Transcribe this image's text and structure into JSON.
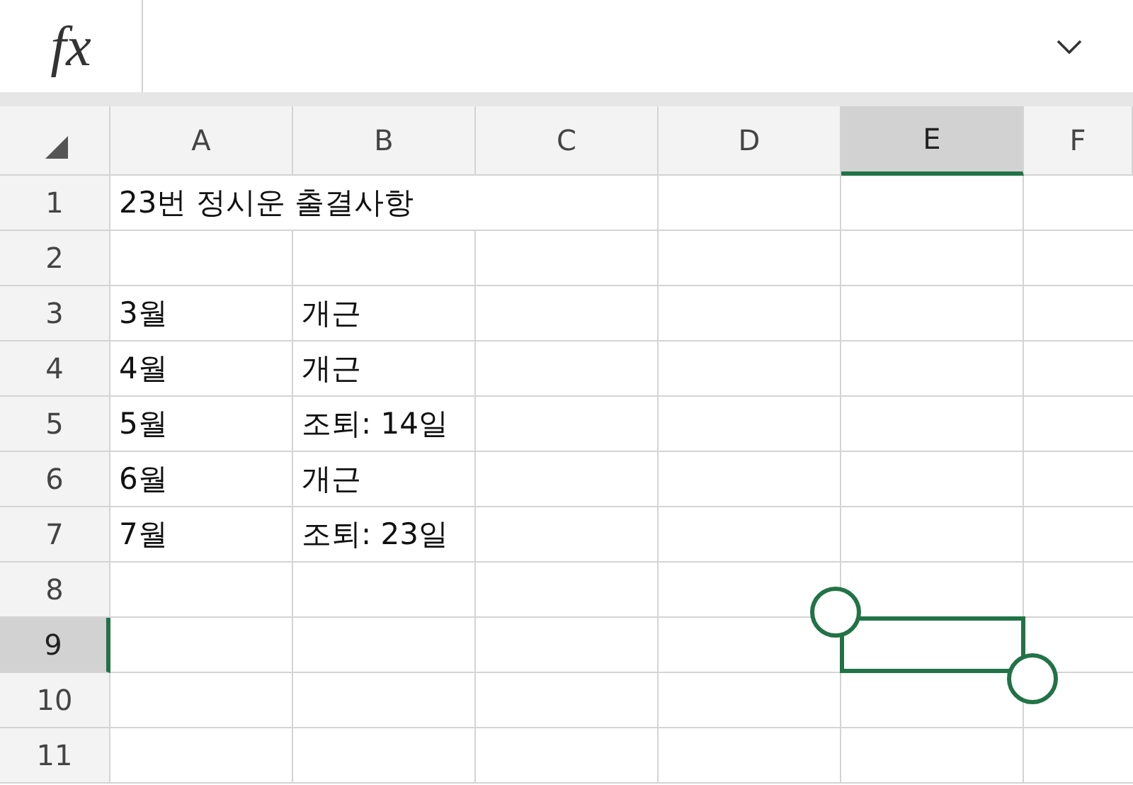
{
  "formula_bar": {
    "fx": "fx"
  },
  "columns": [
    {
      "label": "A",
      "selected": false
    },
    {
      "label": "B",
      "selected": false
    },
    {
      "label": "C",
      "selected": false
    },
    {
      "label": "D",
      "selected": false
    },
    {
      "label": "E",
      "selected": true
    },
    {
      "label": "F",
      "selected": false
    }
  ],
  "rows": [
    {
      "label": "1",
      "selected": false,
      "cells": [
        "23번 정시운 출결사항",
        "",
        "",
        ""
      ]
    },
    {
      "label": "2",
      "selected": false,
      "cells": [
        "",
        "",
        "",
        "",
        "",
        ""
      ]
    },
    {
      "label": "3",
      "selected": false,
      "cells": [
        "3월",
        "개근",
        "",
        "",
        "",
        ""
      ]
    },
    {
      "label": "4",
      "selected": false,
      "cells": [
        "4월",
        "개근",
        "",
        "",
        "",
        ""
      ]
    },
    {
      "label": "5",
      "selected": false,
      "cells": [
        "5월",
        "조퇴: 14일",
        "",
        "",
        "",
        ""
      ]
    },
    {
      "label": "6",
      "selected": false,
      "cells": [
        "6월",
        "개근",
        "",
        "",
        "",
        ""
      ]
    },
    {
      "label": "7",
      "selected": false,
      "cells": [
        "7월",
        "조퇴: 23일",
        "",
        "",
        "",
        ""
      ]
    },
    {
      "label": "8",
      "selected": false,
      "cells": [
        "",
        "",
        "",
        "",
        "",
        ""
      ]
    },
    {
      "label": "9",
      "selected": true,
      "cells": [
        "",
        "",
        "",
        "",
        "",
        ""
      ]
    },
    {
      "label": "10",
      "selected": false,
      "cells": [
        "",
        "",
        "",
        "",
        "",
        ""
      ]
    },
    {
      "label": "11",
      "selected": false,
      "cells": [
        "",
        "",
        "",
        "",
        "",
        ""
      ]
    }
  ]
}
